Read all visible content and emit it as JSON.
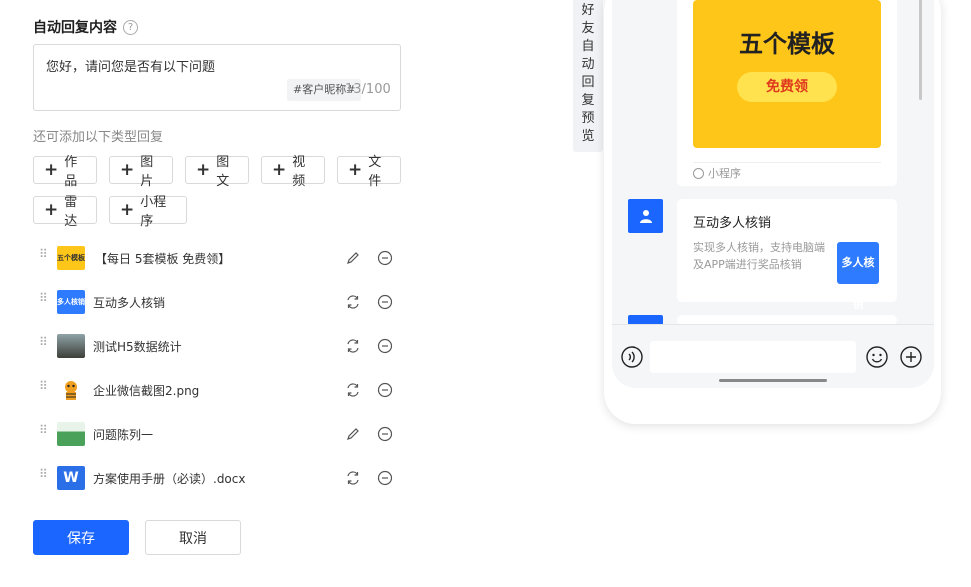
{
  "form": {
    "title": "自动回复内容",
    "reply_text": "您好，请问您是否有以下问题",
    "variable_tag": "#客户昵称#",
    "counter": "13/100",
    "hint": "还可添加以下类型回复",
    "add_buttons": [
      "作品",
      "图片",
      "图文",
      "视频",
      "文件",
      "雷达",
      "小程序"
    ]
  },
  "items": [
    {
      "label": "【每日 5套模板 免费领】",
      "thumb_text": "五个模板"
    },
    {
      "label": "互动多人核销",
      "thumb_text": "多人核销"
    },
    {
      "label": "测试H5数据统计",
      "thumb_text": ""
    },
    {
      "label": "企业微信截图2.png",
      "thumb_text": ""
    },
    {
      "label": "问题陈列一",
      "thumb_text": ""
    },
    {
      "label": "方案使用手册（必读）.docx",
      "thumb_text": "W"
    }
  ],
  "actions": {
    "save": "保存",
    "cancel": "取消"
  },
  "preview": {
    "tab_label": "好友自动回复预览",
    "mini_card": {
      "banner_title": "五个模板",
      "banner_button": "免费领",
      "footer": "小程序"
    },
    "link_card": {
      "title": "互动多人核销",
      "desc": "实现多人核销，支持电脑端及APP端进行奖品核销",
      "thumb_text": "多人核销"
    }
  },
  "colors": {
    "accent": "#1b66ff",
    "banner": "#ffc61a"
  }
}
